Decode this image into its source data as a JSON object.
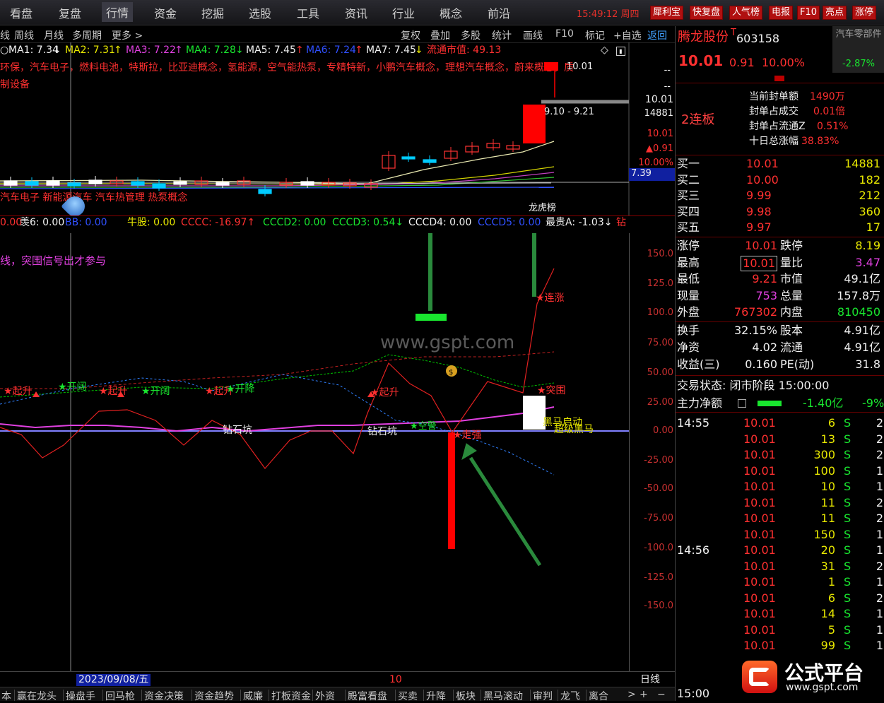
{
  "top_menu": [
    "看盘",
    "复盘",
    "行情",
    "资金",
    "挖掘",
    "选股",
    "工具",
    "资讯",
    "行业",
    "概念",
    "前沿"
  ],
  "active_menu": "行情",
  "clock": "15:49:12 周四",
  "top_buttons": [
    "犀利宝",
    "快复盘",
    "人气榜",
    "电报",
    "F10",
    "亮点",
    "涨停"
  ],
  "period_tabs": [
    "线",
    "周线",
    "月线",
    "多周期",
    "更多 >"
  ],
  "toolbar": [
    "复权",
    "叠加",
    "多股",
    "统计",
    "画线",
    "F10",
    "标记",
    "+自选",
    "返回"
  ],
  "ma": {
    "ma1": "MA1: 7.34",
    "ma2": "MA2: 7.31",
    "ma3": "MA3: 7.22",
    "ma4": "MA4: 7.28",
    "ma5": "MA5: 7.45",
    "ma6": "MA6: 7.24",
    "ma7": "MA7: 7.45",
    "float_mv": "流通市值: 49.13"
  },
  "ma_arrows": {
    "a1": "↓",
    "a2": "↑",
    "a3": "↑",
    "a4": "↓",
    "a5": "↑",
    "a6": "↑",
    "a7": "↓"
  },
  "concepts": "环保，汽车电子，燃料电池，特斯拉，比亚迪概念，氢能源，空气能热泵，专精特新，小鹏汽车概念，理想汽车概念，蔚来概念，质",
  "concepts2": "制设备",
  "price_labels": {
    "top_dashes": "--",
    "dash2": "--",
    "p1": "10.01",
    "vol": "14881",
    "p2": "10.01",
    "chg": "▲0.91",
    "pct": "10.00%",
    "last": "7.39"
  },
  "candle_labels": {
    "high": "10.01",
    "range": "9.10 - 9.21",
    "tag": "龙虎榜"
  },
  "sector_tags": "汽车电子 新能源汽车 汽车热管理 热泵概念",
  "indicator_header": [
    {
      "t": "0.00",
      "c": "red"
    },
    {
      "t": "羡6: 0.00",
      "c": "white"
    },
    {
      "t": "BB: 0.00",
      "c": "blue"
    },
    {
      "t": "牛股: 0.00",
      "c": "yellow"
    },
    {
      "t": "CCCC: -16.97↑",
      "c": "red"
    },
    {
      "t": "CCCD2: 0.00",
      "c": "green"
    },
    {
      "t": "CCCD3: 0.54↓",
      "c": "green"
    },
    {
      "t": "CCCD4: 0.00",
      "c": "white"
    },
    {
      "t": "CCCD5: 0.00",
      "c": "blue"
    },
    {
      "t": "最贵A: -1.03↓",
      "c": "white"
    },
    {
      "t": "钻",
      "c": "red"
    }
  ],
  "indicator_note": "线，突围信号出才参与",
  "indicator_axis": [
    "150.0",
    "125.0",
    "100.0",
    "75.00",
    "50.00",
    "25.00",
    "0.00",
    "-25.00",
    "-50.00",
    "-75.00",
    "-100.0",
    "-125.0",
    "-150.0"
  ],
  "signals": {
    "s1": "★起升",
    "s2": "★开阔",
    "s3": "★起升",
    "s4": "★开阔",
    "s5": "★起升",
    "s6": "★开降",
    "s7": "★起升",
    "diamond1": "钻石坑",
    "diamond2": "钻石坑",
    "warn": "★空警",
    "upmark": "★走强",
    "lianzhang": "★连涨",
    "tuwei": "★突围",
    "heima": "黑马启动",
    "sixing": "超级黑马"
  },
  "watermark": "www.gspt.com",
  "date_label": "2023/09/08/五",
  "date_tick": "10",
  "day_label": "日线",
  "bottom_tabs": [
    "赢在龙头",
    "操盘手",
    "回马枪",
    "资金决策",
    "资金趋势",
    "威廉",
    "打板资金",
    "外资",
    "殿富看盘",
    "买卖",
    "升降",
    "板块",
    "黑马滚动",
    "审判",
    "龙飞",
    "离合"
  ],
  "bottom_first": "本",
  "stock": {
    "name": "腾龙股份",
    "code": "603158",
    "code_mark": "T",
    "sector": "汽车零部件",
    "sector_chg": "-2.87%",
    "price": "10.01",
    "change": "0.91",
    "pct": "10.00%"
  },
  "limit_info": {
    "badge": "2连板",
    "items": [
      [
        "当前封单额",
        "1490万"
      ],
      [
        "封单占成交",
        "0.01倍"
      ],
      [
        "封单占流通Z",
        "0.51%"
      ],
      [
        "十日总涨幅",
        "38.83%"
      ]
    ]
  },
  "order_book": [
    {
      "label": "买一",
      "price": "10.01",
      "vol": "14881"
    },
    {
      "label": "买二",
      "price": "10.00",
      "vol": "182"
    },
    {
      "label": "买三",
      "price": "9.99",
      "vol": "212"
    },
    {
      "label": "买四",
      "price": "9.98",
      "vol": "360"
    },
    {
      "label": "买五",
      "price": "9.97",
      "vol": "17"
    }
  ],
  "quote": [
    {
      "l": "涨停",
      "v": "10.01",
      "l2": "跌停",
      "v2": "8.19"
    },
    {
      "l": "最高",
      "v": "10.01",
      "l2": "量比",
      "v2": "3.47"
    },
    {
      "l": "最低",
      "v": "9.21",
      "l2": "市值",
      "v2": "49.1亿"
    },
    {
      "l": "现量",
      "v": "753",
      "l2": "总量",
      "v2": "157.8万"
    },
    {
      "l": "外盘",
      "v": "767302",
      "l2": "内盘",
      "v2": "810450"
    }
  ],
  "fin": [
    {
      "l": "换手",
      "v": "32.15%",
      "l2": "股本",
      "v2": "4.91亿"
    },
    {
      "l": "净资",
      "v": "4.02",
      "l2": "流通",
      "v2": "4.91亿"
    },
    {
      "l": "收益(三)",
      "v": "0.160",
      "l2": "PE(动)",
      "v2": "31.8"
    }
  ],
  "trade_status": "交易状态: 闭市阶段 15:00:00",
  "main_net": {
    "label": "主力净额",
    "value": "-1.40亿",
    "pct": "-9%"
  },
  "ticks": [
    {
      "time": "14:55",
      "price": "10.01",
      "vol": "6",
      "side": "S",
      "n": "2"
    },
    {
      "time": "",
      "price": "10.01",
      "vol": "13",
      "side": "S",
      "n": "2"
    },
    {
      "time": "",
      "price": "10.01",
      "vol": "300",
      "side": "S",
      "n": "2"
    },
    {
      "time": "",
      "price": "10.01",
      "vol": "100",
      "side": "S",
      "n": "1"
    },
    {
      "time": "",
      "price": "10.01",
      "vol": "10",
      "side": "S",
      "n": "1"
    },
    {
      "time": "",
      "price": "10.01",
      "vol": "11",
      "side": "S",
      "n": "2"
    },
    {
      "time": "",
      "price": "10.01",
      "vol": "11",
      "side": "S",
      "n": "2"
    },
    {
      "time": "",
      "price": "10.01",
      "vol": "150",
      "side": "S",
      "n": "1"
    },
    {
      "time": "14:56",
      "price": "10.01",
      "vol": "20",
      "side": "S",
      "n": "1"
    },
    {
      "time": "",
      "price": "10.01",
      "vol": "31",
      "side": "S",
      "n": "2"
    },
    {
      "time": "",
      "price": "10.01",
      "vol": "1",
      "side": "S",
      "n": "1"
    },
    {
      "time": "",
      "price": "10.01",
      "vol": "6",
      "side": "S",
      "n": "2"
    },
    {
      "time": "",
      "price": "10.01",
      "vol": "14",
      "side": "S",
      "n": "1"
    },
    {
      "time": "",
      "price": "10.01",
      "vol": "5",
      "side": "S",
      "n": "1"
    },
    {
      "time": "",
      "price": "10.01",
      "vol": "99",
      "side": "S",
      "n": "1"
    }
  ],
  "last_time": "15:00",
  "logo": {
    "title": "公式平台",
    "url": "www.gspt.com"
  }
}
